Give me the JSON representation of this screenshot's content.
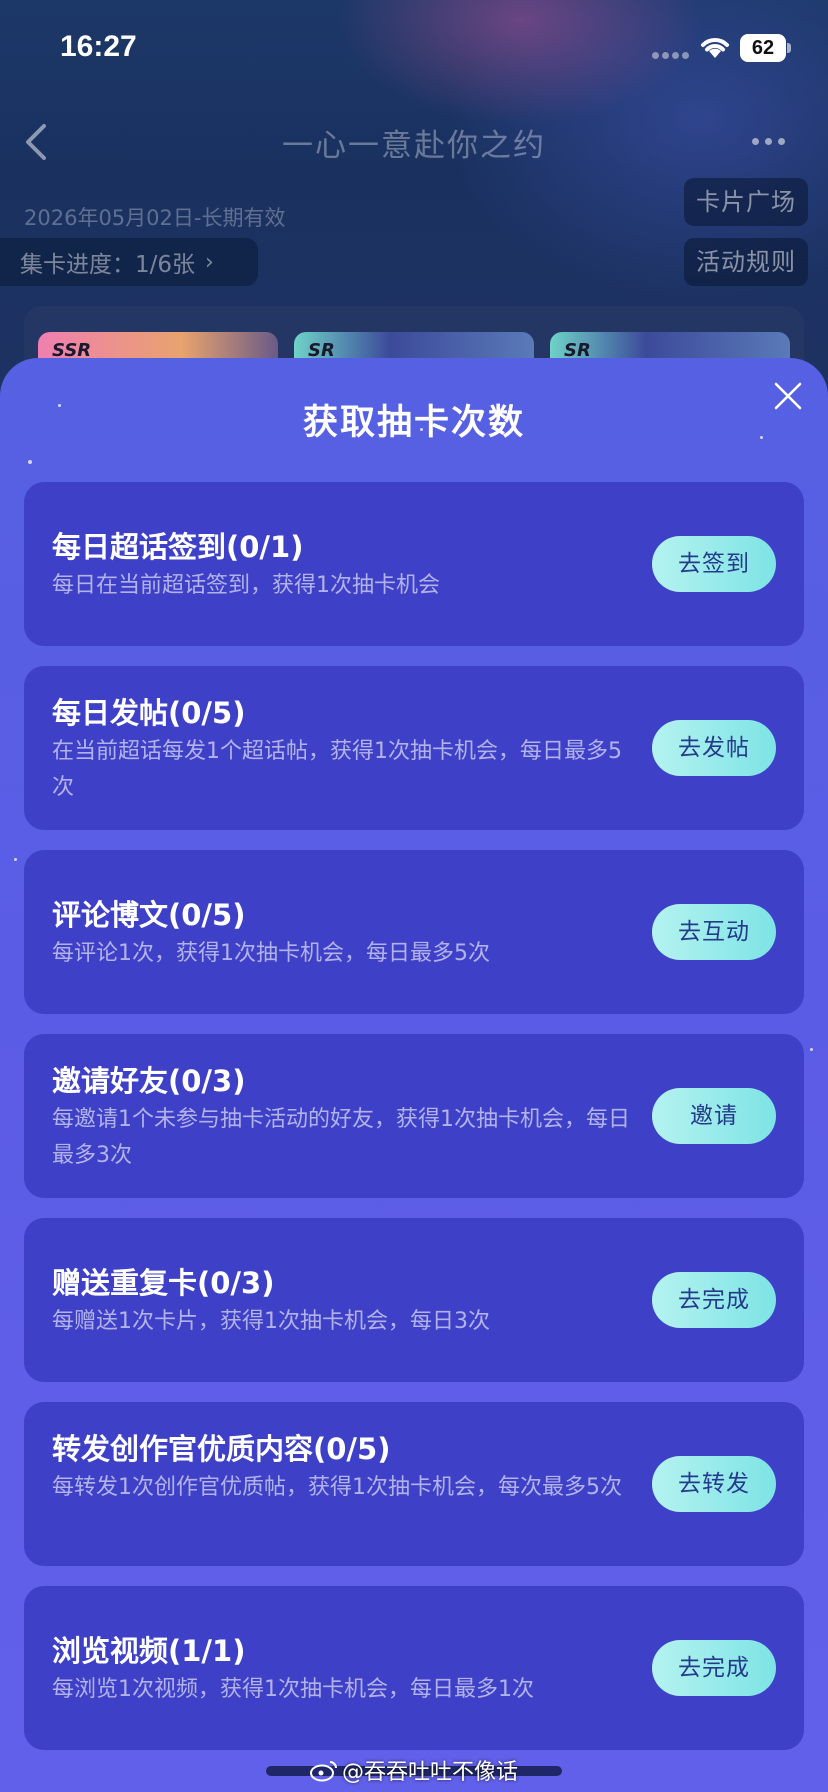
{
  "status_bar": {
    "time": "16:27",
    "battery": "62"
  },
  "nav": {
    "title": "一心一意赴你之约"
  },
  "page": {
    "date_range": "2026年05月02日-长期有效",
    "progress_label": "集卡进度：1/6张",
    "card_square_label": "卡片广场",
    "rules_label": "活动规则",
    "card_rarities": [
      "SSR",
      "SR",
      "SR"
    ]
  },
  "sheet": {
    "title": "获取抽卡次数",
    "tasks": [
      {
        "name": "每日超话签到(0/1)",
        "desc": "每日在当前超话签到，获得1次抽卡机会",
        "button": "去签到"
      },
      {
        "name": "每日发帖(0/5)",
        "desc": "在当前超话每发1个超话帖，获得1次抽卡机会，每日最多5次",
        "button": "去发帖"
      },
      {
        "name": "评论博文(0/5)",
        "desc": "每评论1次，获得1次抽卡机会，每日最多5次",
        "button": "去互动"
      },
      {
        "name": "邀请好友(0/3)",
        "desc": "每邀请1个未参与抽卡活动的好友，获得1次抽卡机会，每日最多3次",
        "button": "邀请"
      },
      {
        "name": "赠送重复卡(0/3)",
        "desc": "每赠送1次卡片，获得1次抽卡机会，每日3次",
        "button": "去完成"
      },
      {
        "name": "转发创作官优质内容(0/5)",
        "desc": "每转发1次创作官优质帖，获得1次抽卡机会，每次最多5次",
        "button": "去转发"
      },
      {
        "name": "浏览视频(1/1)",
        "desc": "每浏览1次视频，获得1次抽卡机会，每日最多1次",
        "button": "去完成"
      }
    ]
  },
  "watermark": "@吞吞吐吐不像话"
}
